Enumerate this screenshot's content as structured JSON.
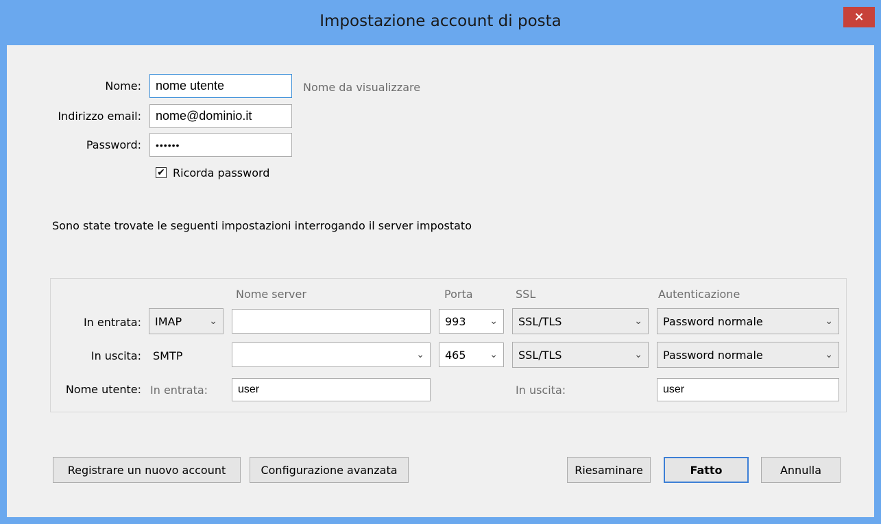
{
  "window": {
    "title": "Impostazione account di posta",
    "close_label": "×"
  },
  "identity": {
    "name_label": "Nome:",
    "name_value": "nome utente",
    "name_hint": "Nome da visualizzare",
    "email_label": "Indirizzo email:",
    "email_value": "nome@dominio.it",
    "password_label": "Password:",
    "password_value": "••••••",
    "remember_label": "Ricorda password",
    "remember_checked": true,
    "check_glyph": "✔"
  },
  "message": "Sono state trovate le seguenti impostazioni interrogando il server impostato",
  "servers": {
    "col_server": "Nome server",
    "col_port": "Porta",
    "col_ssl": "SSL",
    "col_auth": "Autenticazione",
    "incoming": {
      "label": "In entrata:",
      "protocol": "IMAP",
      "server": "",
      "port": "993",
      "ssl": "SSL/TLS",
      "auth": "Password normale"
    },
    "outgoing": {
      "label": "In uscita:",
      "protocol": "SMTP",
      "server": "",
      "port": "465",
      "ssl": "SSL/TLS",
      "auth": "Password normale"
    },
    "username": {
      "label": "Nome utente:",
      "in_label": "In entrata:",
      "in_value": "user",
      "out_label": "In uscita:",
      "out_value": "user"
    },
    "chevron": "⌄"
  },
  "buttons": {
    "register": "Registrare un nuovo account",
    "advanced": "Configurazione avanzata",
    "retest": "Riesaminare",
    "done": "Fatto",
    "cancel": "Annulla"
  }
}
